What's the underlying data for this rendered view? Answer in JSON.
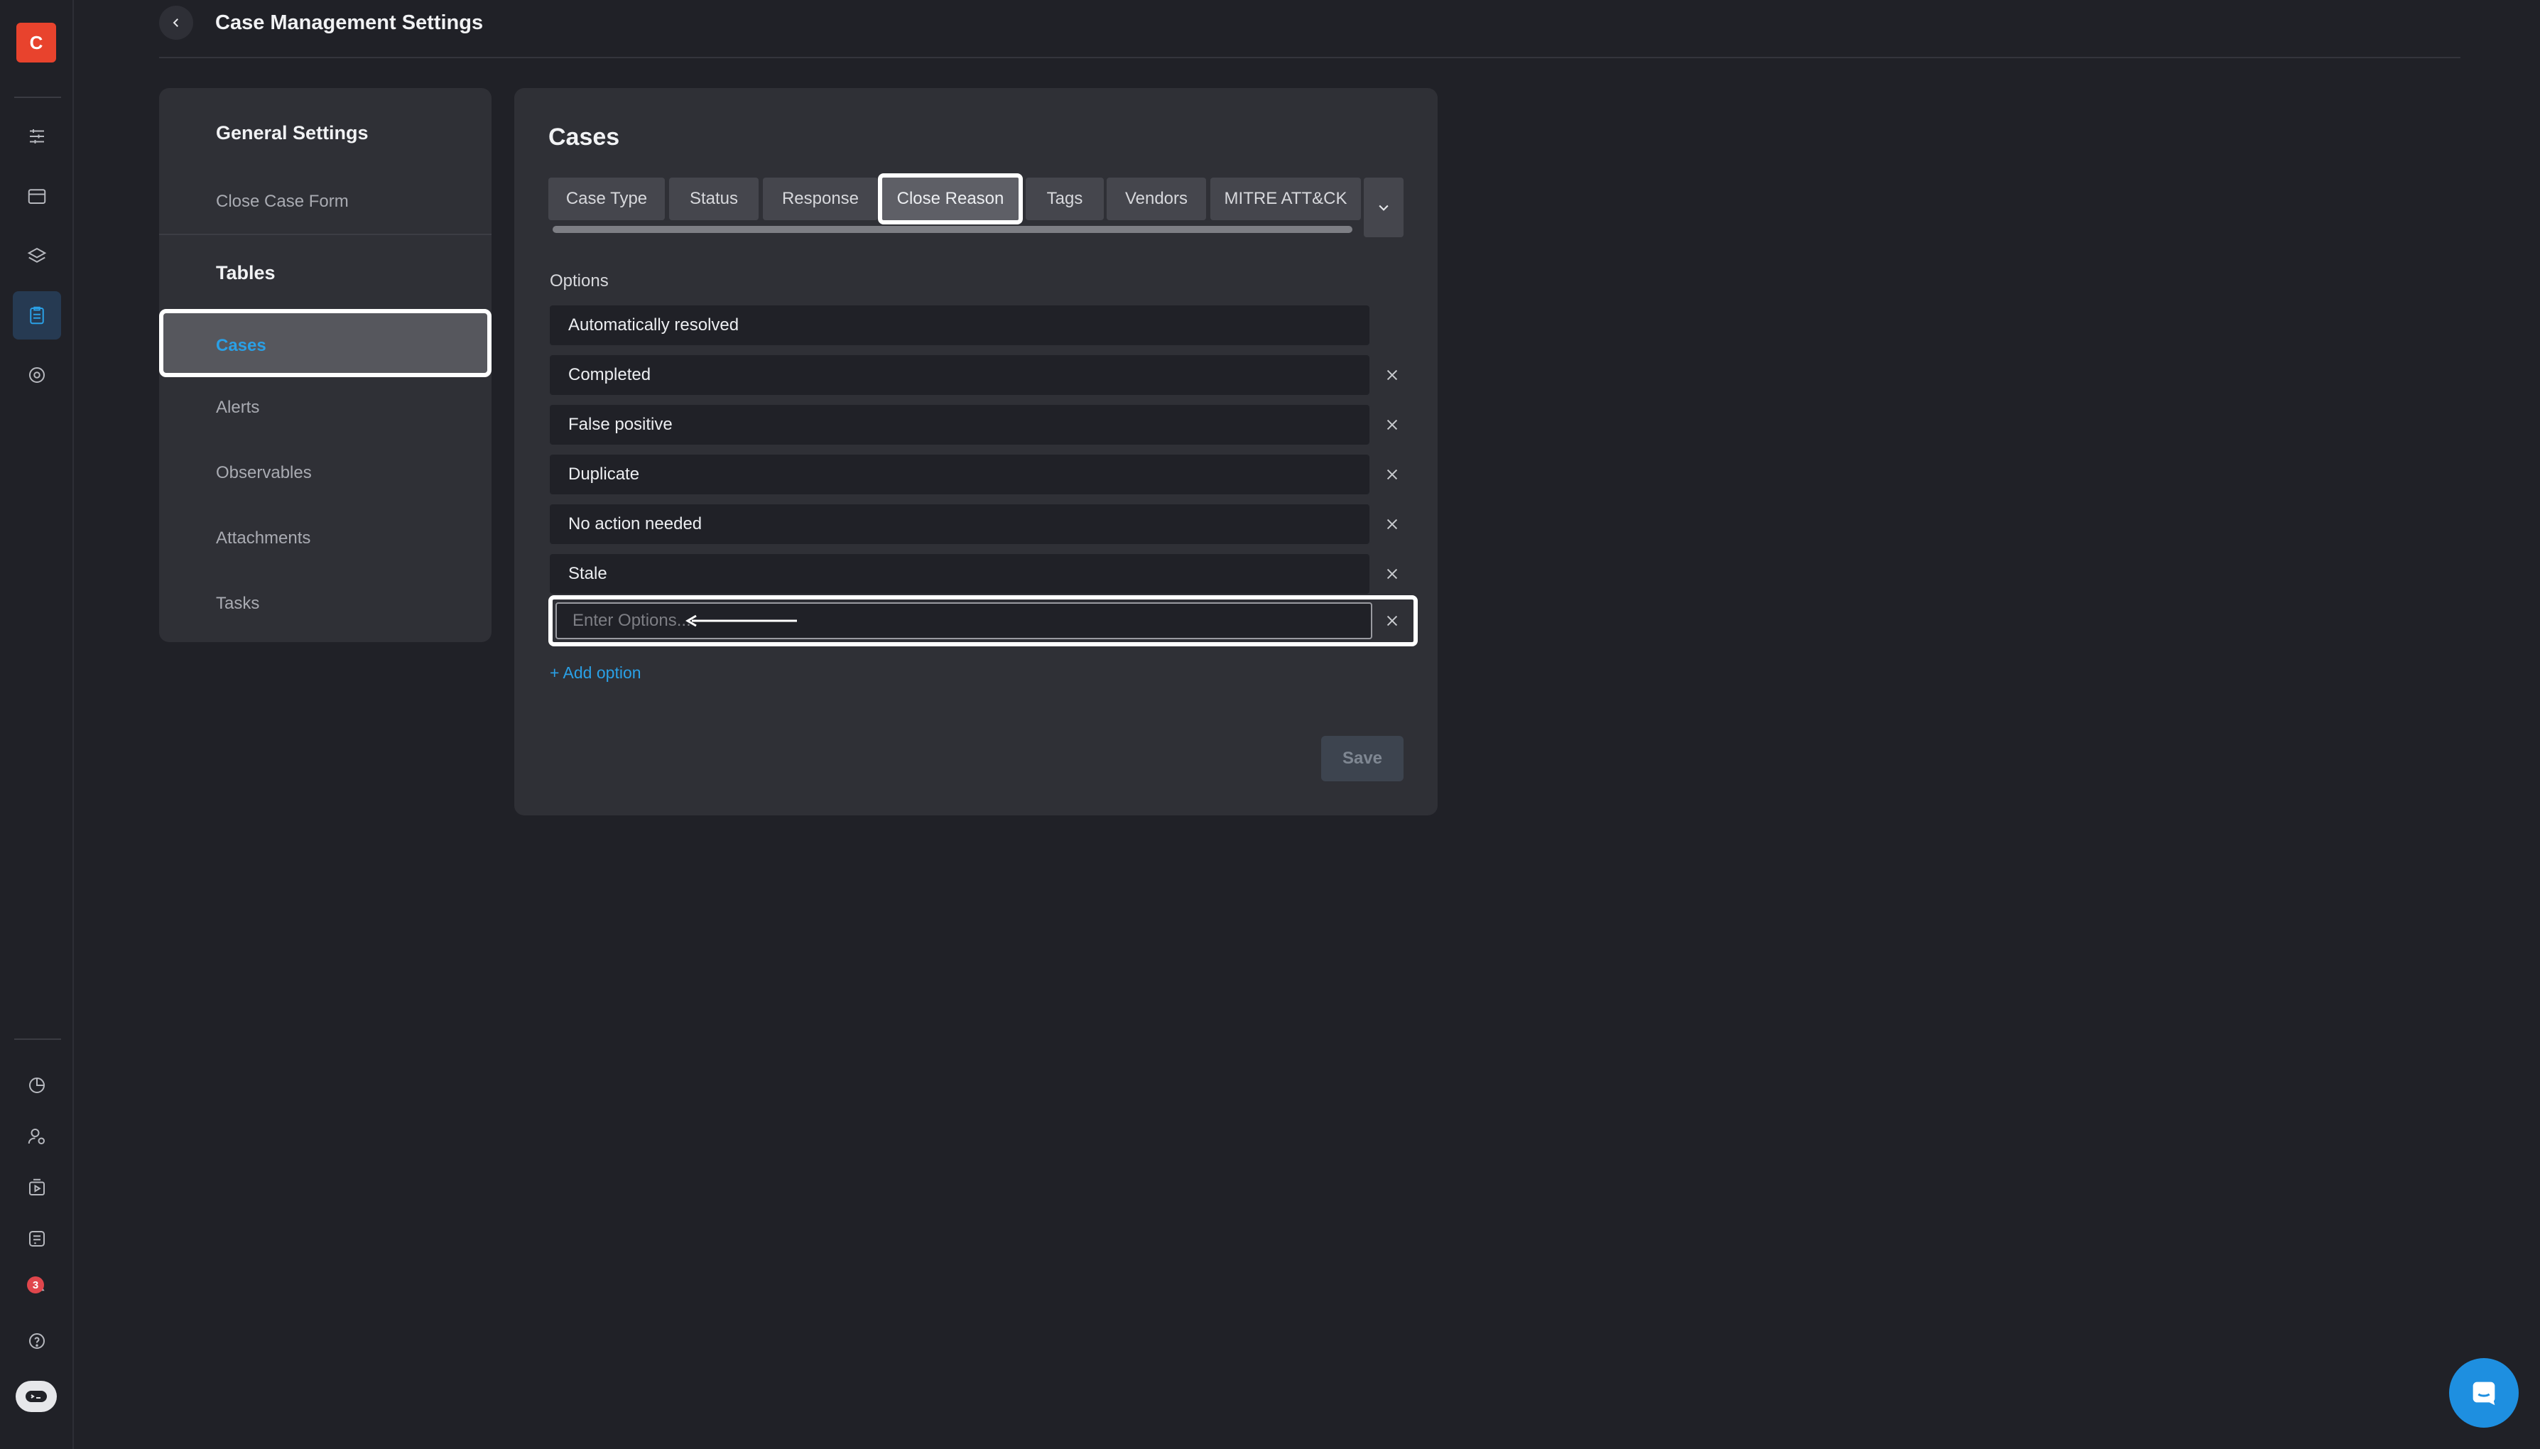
{
  "rail": {
    "logo_letter": "C",
    "notification_count": "3",
    "icons": [
      "tasks-icon",
      "calendar-icon",
      "layers-icon",
      "cases-icon",
      "target-icon",
      "chart-pie-icon",
      "user-settings-icon",
      "playbook-icon",
      "integrations-icon",
      "notifications-icon",
      "help-icon",
      "bot-icon"
    ]
  },
  "header": {
    "title": "Case Management Settings"
  },
  "sidebar": {
    "general_heading": "General Settings",
    "close_case_form": "Close Case Form",
    "tables_heading": "Tables",
    "items": [
      "Cases",
      "Alerts",
      "Observables",
      "Attachments",
      "Tasks"
    ],
    "active_item": "Cases"
  },
  "main": {
    "title": "Cases",
    "tabs": [
      "Case Type",
      "Status",
      "Response",
      "Close Reason",
      "Tags",
      "Vendors",
      "MITRE ATT&CK"
    ],
    "active_tab": "Close Reason",
    "options_label": "Options",
    "options": [
      "Automatically resolved",
      "Completed",
      "False positive",
      "Duplicate",
      "No action needed",
      "Stale"
    ],
    "new_option_placeholder": "Enter Options...",
    "new_option_value": "",
    "add_option": "+ Add option",
    "save": "Save"
  },
  "colors": {
    "background": "#202127",
    "panel": "#2f3036",
    "accent": "#2aa0e6",
    "brand": "#e8432d"
  }
}
